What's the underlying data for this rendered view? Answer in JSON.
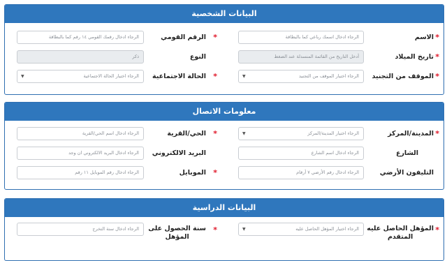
{
  "personal": {
    "title": "البيانات الشخصية",
    "name_label": "الاسم",
    "name_placeholder": "الرجاء ادخال اسمك رباعي كما بالبطاقة",
    "national_id_label": "الرقم القومي",
    "national_id_placeholder": "الرجاء ادخال رقمك القومي ١٤ رقم كما بالبطاقة",
    "birthdate_label": "تاريخ الميلاد",
    "birthdate_placeholder": "أدخل التاريخ من القائمة المنسدلة عند الضغط",
    "gender_label": "النوع",
    "gender_value": "ذكر",
    "military_label": "الموقف من التجنيد",
    "military_placeholder": "الرجاء اختيار الموقف من التجنيد",
    "marital_label": "الحالة الاجتماعية",
    "marital_placeholder": "الرجاء اختيار الحالة الاجتماعية"
  },
  "contact": {
    "title": "معلومات الاتصال",
    "city_label": "المدينة/المركز",
    "city_placeholder": "الرجاء اختيار المدينة/المركز",
    "district_label": "الحي/القرية",
    "district_placeholder": "الرجاء ادخال اسم الحي/القرية",
    "street_label": "الشارع",
    "street_placeholder": "الرجاء ادخال اسم الشارع",
    "email_label": "البريد الالكتروني",
    "email_placeholder": "الرجاء ادخال البريد الالكتروني ان وجد",
    "phone_label": "التليفون الأرضي",
    "phone_placeholder": "الرجاء ادخال رقم الأرضي ٧ أرقام",
    "mobile_label": "الموبايل",
    "mobile_placeholder": "الرجاء ادخال رقم الموبايل ١١ رقم"
  },
  "education": {
    "title": "البيانات الدراسية",
    "qualification_label_line1": "المؤهل الحاصل عليه",
    "qualification_label_line2": "المتقدم",
    "qualification_placeholder": "الرجاء اختيار المؤهل الحاصل عليه",
    "grad_year_label_line1": "سنة الحصول على",
    "grad_year_label_line2": "المؤهل",
    "grad_year_placeholder": "الرجاء ادخال سنة التخرج"
  },
  "icons": {
    "required_mark": "*",
    "dropdown_caret": "▼"
  },
  "colors": {
    "header_blue": "#2f77bd",
    "required_red": "#e0192b"
  }
}
